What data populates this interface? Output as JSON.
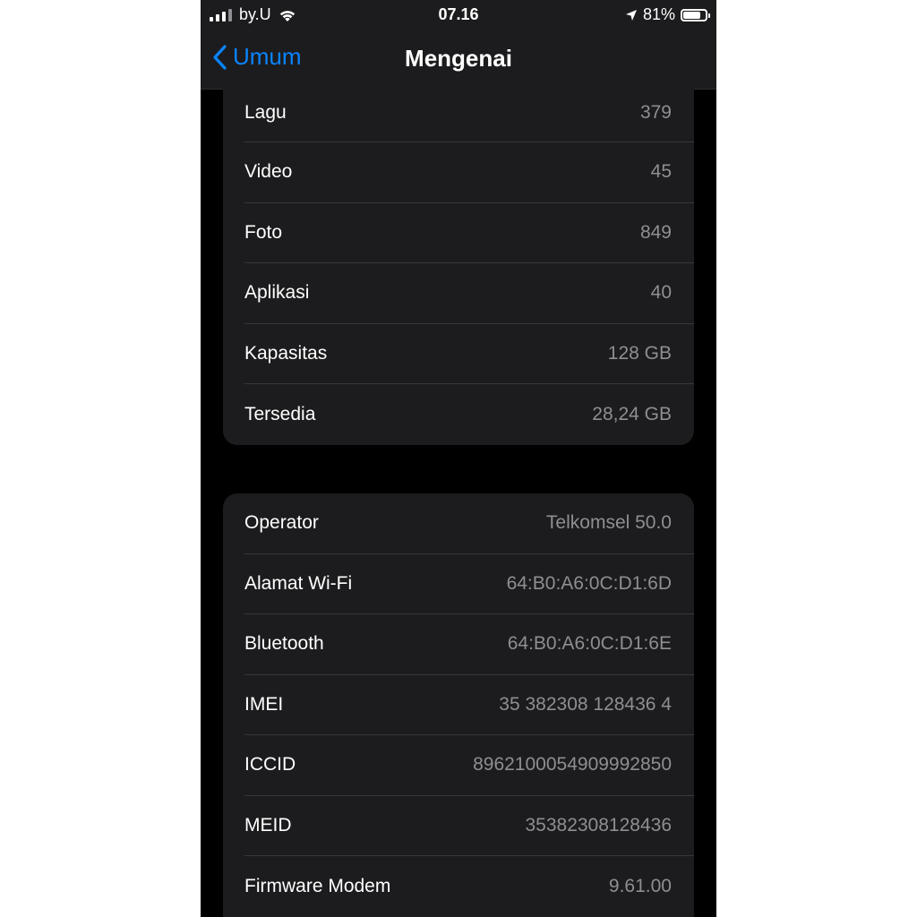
{
  "status_bar": {
    "carrier": "by.U",
    "time": "07.16",
    "battery_percent": "81%",
    "battery_level": 0.81
  },
  "nav": {
    "back_label": "Umum",
    "title": "Mengenai"
  },
  "media_group": [
    {
      "label": "Lagu",
      "value": "379"
    },
    {
      "label": "Video",
      "value": "45"
    },
    {
      "label": "Foto",
      "value": "849"
    },
    {
      "label": "Aplikasi",
      "value": "40"
    },
    {
      "label": "Kapasitas",
      "value": "128 GB"
    },
    {
      "label": "Tersedia",
      "value": "28,24 GB"
    }
  ],
  "network_group": [
    {
      "label": "Operator",
      "value": "Telkomsel 50.0"
    },
    {
      "label": "Alamat Wi-Fi",
      "value": "64:B0:A6:0C:D1:6D"
    },
    {
      "label": "Bluetooth",
      "value": "64:B0:A6:0C:D1:6E"
    },
    {
      "label": "IMEI",
      "value": "35 382308 128436 4"
    },
    {
      "label": "ICCID",
      "value": "8962100054909992850"
    },
    {
      "label": "MEID",
      "value": "35382308128436"
    },
    {
      "label": "Firmware Modem",
      "value": "9.61.00"
    }
  ],
  "colors": {
    "accent": "#0a84ff",
    "cell_background": "#1c1c1e",
    "secondary_text": "#8e8e93"
  }
}
